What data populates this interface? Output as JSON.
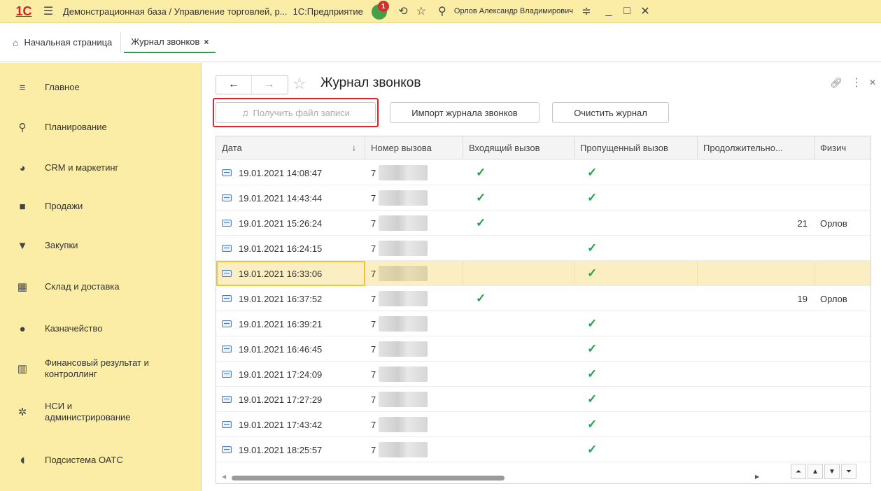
{
  "titlebar": {
    "logo": "1С",
    "title": "Демонстрационная база / Управление торговлей, р...",
    "app": "1С:Предприятие",
    "notifications_count": "1",
    "user": "Орлов Александр Владимирович"
  },
  "tabs": {
    "home": "Начальная страница",
    "journal": "Журнал звонков",
    "close": "×"
  },
  "sidebar": {
    "items": [
      {
        "label": "Главное",
        "icon": "menu-icon"
      },
      {
        "label": "Планирование",
        "icon": "planning-icon"
      },
      {
        "label": "CRM и маркетинг",
        "icon": "pie-chart-icon"
      },
      {
        "label": "Продажи",
        "icon": "bag-icon"
      },
      {
        "label": "Закупки",
        "icon": "cart-icon"
      },
      {
        "label": "Склад и доставка",
        "icon": "warehouse-icon"
      },
      {
        "label": "Казначейство",
        "icon": "ruble-icon"
      },
      {
        "label": "Финансовый результат и контроллинг",
        "icon": "bar-chart-icon"
      },
      {
        "label": "НСИ и администрирование",
        "icon": "gear-icon"
      },
      {
        "label": "Подсистема ОАТС",
        "icon": "headset-icon"
      }
    ]
  },
  "page": {
    "title": "Журнал звонков",
    "buttons": {
      "get_record": "Получить файл записи",
      "import": "Импорт журнала звонков",
      "clear": "Очистить журнал"
    }
  },
  "table": {
    "columns": [
      "Дата",
      "Номер вызова",
      "Входящий вызов",
      "Пропущенный вызов",
      "Продолжительно...",
      "Физич"
    ],
    "rows": [
      {
        "date": "19.01.2021 14:08:47",
        "number": "7",
        "incoming": true,
        "missed": true,
        "duration": "",
        "person": ""
      },
      {
        "date": "19.01.2021 14:43:44",
        "number": "7",
        "incoming": true,
        "missed": true,
        "duration": "",
        "person": ""
      },
      {
        "date": "19.01.2021 15:26:24",
        "number": "7",
        "incoming": true,
        "missed": false,
        "duration": "21",
        "person": "Орлов"
      },
      {
        "date": "19.01.2021 16:24:15",
        "number": "7",
        "incoming": false,
        "missed": true,
        "duration": "",
        "person": ""
      },
      {
        "date": "19.01.2021 16:33:06",
        "number": "7",
        "incoming": false,
        "missed": true,
        "duration": "",
        "person": "",
        "selected": true
      },
      {
        "date": "19.01.2021 16:37:52",
        "number": "7",
        "incoming": true,
        "missed": false,
        "duration": "19",
        "person": "Орлов"
      },
      {
        "date": "19.01.2021 16:39:21",
        "number": "7",
        "incoming": false,
        "missed": true,
        "duration": "",
        "person": ""
      },
      {
        "date": "19.01.2021 16:46:45",
        "number": "7",
        "incoming": false,
        "missed": true,
        "duration": "",
        "person": ""
      },
      {
        "date": "19.01.2021 17:24:09",
        "number": "7",
        "incoming": false,
        "missed": true,
        "duration": "",
        "person": ""
      },
      {
        "date": "19.01.2021 17:27:29",
        "number": "7",
        "incoming": false,
        "missed": true,
        "duration": "",
        "person": ""
      },
      {
        "date": "19.01.2021 17:43:42",
        "number": "7",
        "incoming": false,
        "missed": true,
        "duration": "",
        "person": ""
      },
      {
        "date": "19.01.2021 18:25:57",
        "number": "7",
        "incoming": false,
        "missed": true,
        "duration": "",
        "person": ""
      }
    ],
    "check_glyph": "✓"
  },
  "colors": {
    "sidebar_bg": "#fbeda5",
    "accent_green": "#24a24a",
    "highlight_red": "#e2252b",
    "selected_row": "#fbeec3"
  }
}
